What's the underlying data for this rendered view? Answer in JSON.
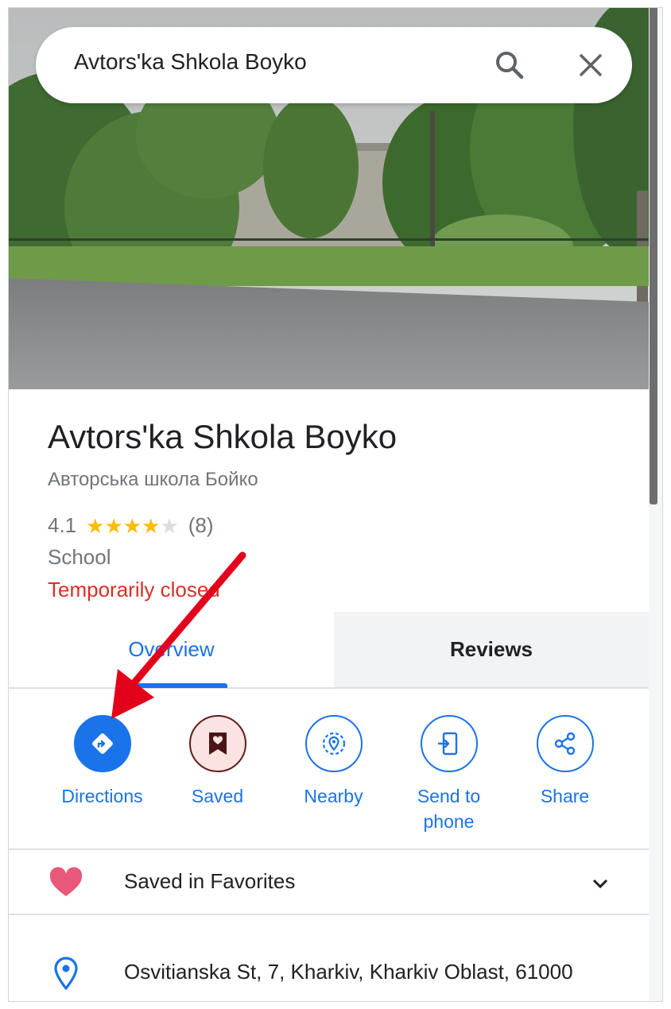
{
  "search": {
    "query": "Avtors'ka Shkola Boyko",
    "search_icon": "search-icon",
    "close_icon": "close-icon"
  },
  "place": {
    "name": "Avtors'ka Shkola Boyko",
    "local_name": "Авторська школа Бойко",
    "rating": "4.1",
    "rating_stars_filled": 4,
    "rating_stars_total": 5,
    "review_count": "(8)",
    "category": "School",
    "status": "Temporarily closed",
    "status_color": "#d93025"
  },
  "tabs": [
    {
      "label": "Overview",
      "active": true
    },
    {
      "label": "Reviews",
      "active": false
    }
  ],
  "actions": [
    {
      "label": "Directions",
      "icon": "directions-icon"
    },
    {
      "label": "Saved",
      "icon": "saved-bookmark-icon"
    },
    {
      "label": "Nearby",
      "icon": "nearby-icon"
    },
    {
      "label": "Send to phone",
      "icon": "send-to-phone-icon"
    },
    {
      "label": "Share",
      "icon": "share-icon"
    }
  ],
  "favorites": {
    "label": "Saved in Favorites",
    "icon": "heart-icon",
    "heart_color": "#e8587a"
  },
  "address": {
    "text": "Osvitianska St, 7, Kharkiv, Kharkiv Oblast, 61000",
    "icon": "location-pin-icon"
  },
  "colors": {
    "accent": "#1a73e8",
    "annotation": "#e3001b"
  }
}
